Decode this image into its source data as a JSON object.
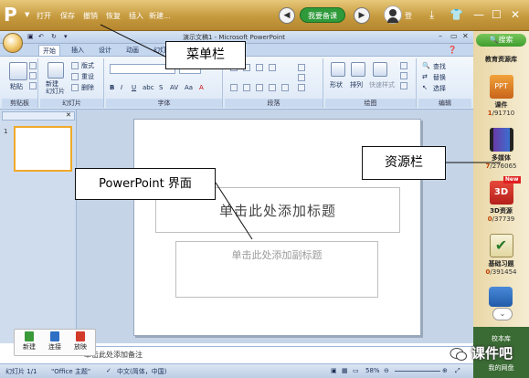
{
  "topbar": {
    "menu": [
      "打开",
      "保存",
      "撤销",
      "恢复",
      "插入",
      "新建..."
    ],
    "center_button": "我要备课",
    "login": "登"
  },
  "ppt": {
    "title": "演示文稿1 - Microsoft PowerPoint",
    "tabs": [
      "开始",
      "插入",
      "设计",
      "动画",
      "幻灯片放映",
      "审阅",
      "视图"
    ],
    "ribbon": {
      "clipboard": {
        "label": "剪贴板",
        "paste": "粘贴"
      },
      "slides": {
        "label": "幻灯片",
        "new_slide": "新建\n幻灯片",
        "layout": "版式",
        "reset": "重设",
        "delete": "删除"
      },
      "font": {
        "label": "字体"
      },
      "paragraph": {
        "label": "段落"
      },
      "drawing": {
        "label": "绘图",
        "shapes": "形状",
        "arrange": "排列",
        "quick_styles": "快速样式"
      },
      "editing": {
        "label": "编辑",
        "find": "查找",
        "replace": "替换",
        "select": "选择"
      }
    },
    "slide": {
      "title_placeholder": "单击此处添加标题",
      "subtitle_placeholder": "单击此处添加副标题"
    },
    "slide_number": "1",
    "notes_placeholder": "单击此处添加备注",
    "float_tools": [
      "新建",
      "连接",
      "放映"
    ],
    "status": {
      "slide": "幻灯片 1/1",
      "theme": "\"Office 主题\"",
      "language": "中文(简体，中国)",
      "zoom": "58%"
    }
  },
  "sidebar": {
    "search": "搜索",
    "title": "教育资源库",
    "items": [
      {
        "name": "课件",
        "icon": "ppt-icon",
        "count_hl": "1",
        "count_total": "/91710"
      },
      {
        "name": "多媒体",
        "icon": "film-icon",
        "count_hl": "7",
        "count_total": "/276065"
      },
      {
        "name": "3D资源",
        "icon": "3d-icon",
        "count_hl": "0",
        "count_total": "/37739",
        "badge": "New"
      },
      {
        "name": "基础习题",
        "icon": "checklist-icon",
        "count_hl": "0",
        "count_total": "/391454"
      }
    ],
    "library": "校本库",
    "disk": "我的网盘"
  },
  "callouts": {
    "menubar": "菜单栏",
    "interface": "PowerPoint 界面",
    "resource": "资源栏"
  },
  "watermark": "课件吧"
}
